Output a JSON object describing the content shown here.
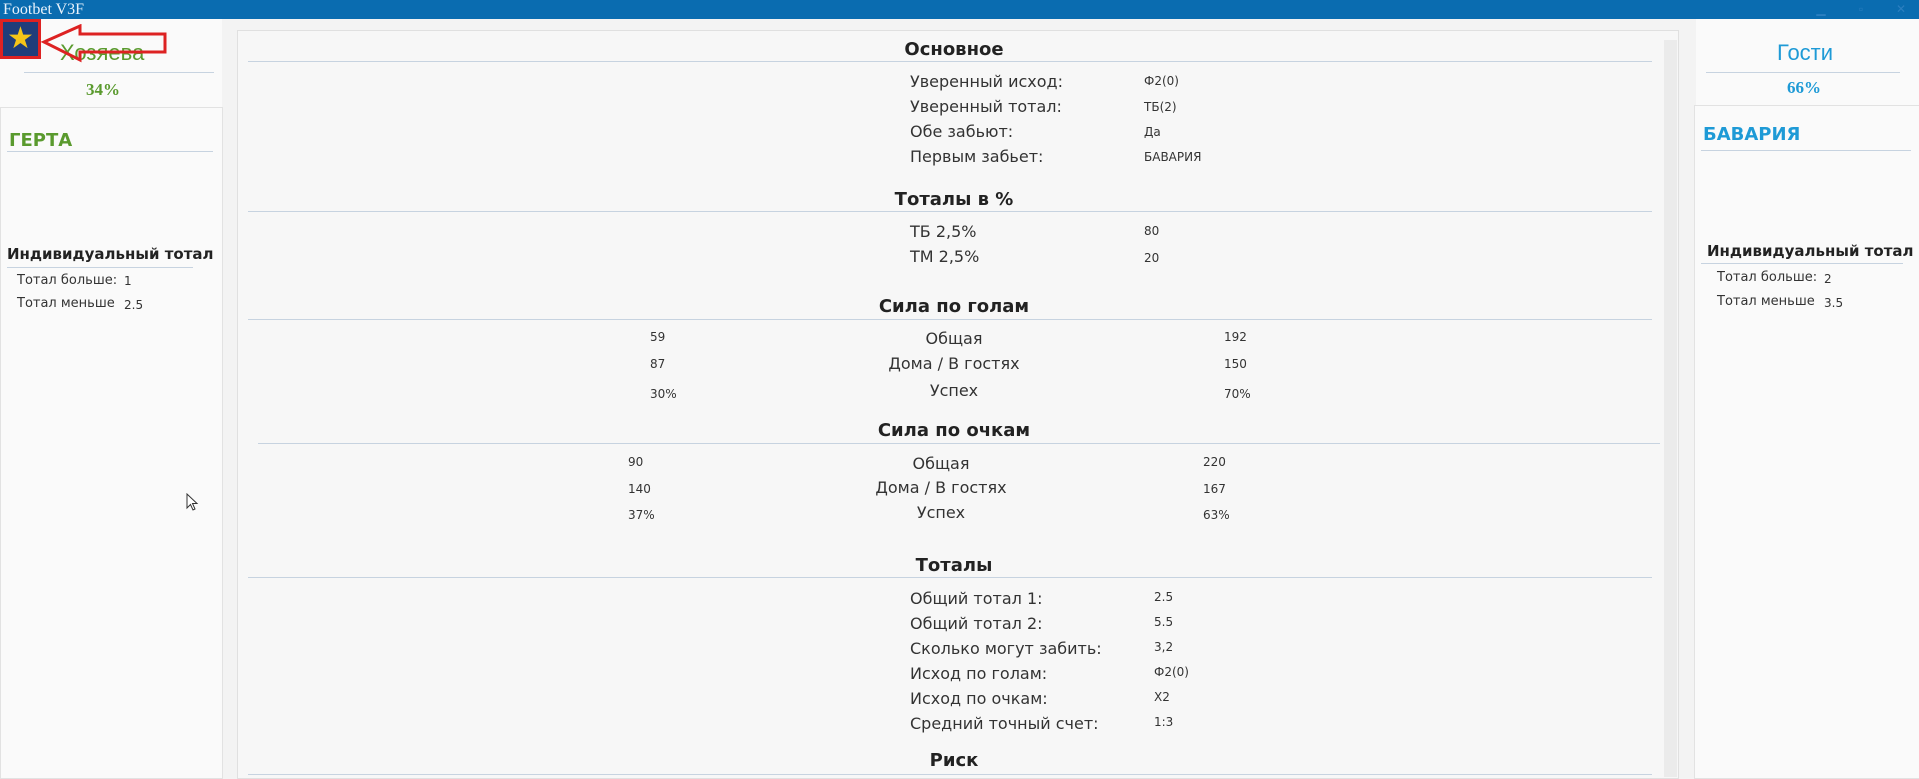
{
  "window": {
    "title": "Footbet V3F"
  },
  "home": {
    "label": "Хозяева",
    "pct": "34%",
    "team": "ГЕРТА",
    "indiv_title": "Индивидуальный тотал",
    "rows": [
      {
        "label": "Тотал больше:",
        "value": "1"
      },
      {
        "label": "Тотал меньше",
        "value": "2.5"
      }
    ]
  },
  "away": {
    "label": "Гости",
    "pct": "66%",
    "team": "БАВАРИЯ",
    "indiv_title": "Индивидуальный тотал",
    "rows": [
      {
        "label": "Тотал больше:",
        "value": "2"
      },
      {
        "label": "Тотал меньше",
        "value": "3.5"
      }
    ]
  },
  "main": {
    "title": "Основное",
    "rows": [
      {
        "label": "Уверенный исход:",
        "value": "Ф2(0)"
      },
      {
        "label": "Уверенный тотал:",
        "value": "ТБ(2)"
      },
      {
        "label": "Обе забьют:",
        "value": "Да"
      },
      {
        "label": "Первым забьет:",
        "value": "БАВАРИЯ"
      }
    ]
  },
  "totals_pct": {
    "title": "Тоталы в %",
    "rows": [
      {
        "label": "ТБ 2,5%",
        "value": "80"
      },
      {
        "label": "ТМ 2,5%",
        "value": "20"
      }
    ]
  },
  "goals_power": {
    "title": "Сила по голам",
    "rows": [
      {
        "home": "59",
        "label": "Общая",
        "away": "192"
      },
      {
        "home": "87",
        "label": "Дома / В гостях",
        "away": "150"
      },
      {
        "home": "30%",
        "label": "Успех",
        "away": "70%"
      }
    ]
  },
  "points_power": {
    "title": "Сила по очкам",
    "rows": [
      {
        "home": "90",
        "label": "Общая",
        "away": "220"
      },
      {
        "home": "140",
        "label": "Дома / В гостях",
        "away": "167"
      },
      {
        "home": "37%",
        "label": "Успех",
        "away": "63%"
      }
    ]
  },
  "totals": {
    "title": "Тоталы",
    "rows": [
      {
        "label": "Общий тотал 1:",
        "value": "2.5"
      },
      {
        "label": "Общий тотал 2:",
        "value": "5.5"
      },
      {
        "label": "Сколько могут забить:",
        "value": "3,2"
      },
      {
        "label": "Исход по голам:",
        "value": "Ф2(0)"
      },
      {
        "label": "Исход по очкам:",
        "value": "Х2"
      },
      {
        "label": "Средний точный счет:",
        "value": "1:3"
      }
    ]
  },
  "risk": {
    "title": "Риск"
  },
  "icons": {
    "star": "star-icon",
    "back": "arrow-left-icon",
    "cursor": "mouse-pointer-icon"
  },
  "colors": {
    "home": "#5a9a2e",
    "away": "#1e9ad6",
    "titlebar": "#0a6cb0",
    "back_button": "#3bbf6a"
  }
}
